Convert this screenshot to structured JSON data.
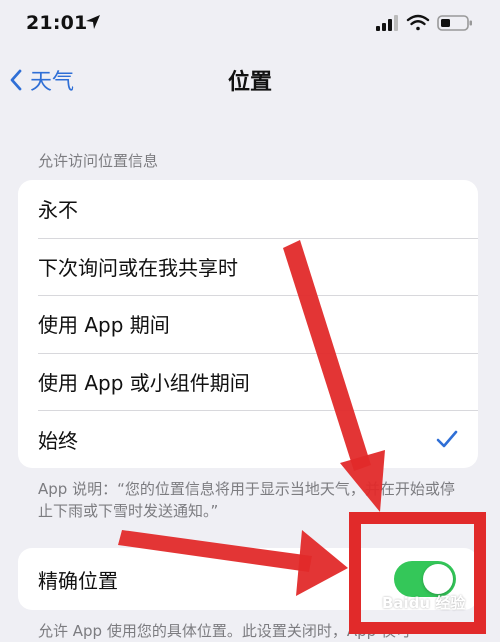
{
  "status_bar": {
    "time": "21:01"
  },
  "nav": {
    "back_label": "天气",
    "title": "位置"
  },
  "section_header": "允许访问位置信息",
  "options": [
    {
      "label": "永不",
      "selected": false
    },
    {
      "label": "下次询问或在我共享时",
      "selected": false
    },
    {
      "label": "使用 App 期间",
      "selected": false
    },
    {
      "label": "使用 App 或小组件期间",
      "selected": false
    },
    {
      "label": "始终",
      "selected": true
    }
  ],
  "app_description": "App 说明：“您的位置信息将用于显示当地天气，并在开始或停止下雨或下雪时发送通知。”",
  "precise_location": {
    "label": "精确位置",
    "enabled": true
  },
  "precise_footnote": "允许 App 使用您的具体位置。此设置关闭时，App 仅可",
  "watermark": "Baidu 经验",
  "colors": {
    "accent_blue": "#2f6fd6",
    "toggle_green": "#34c759",
    "annotation_red": "#e12a2a"
  }
}
